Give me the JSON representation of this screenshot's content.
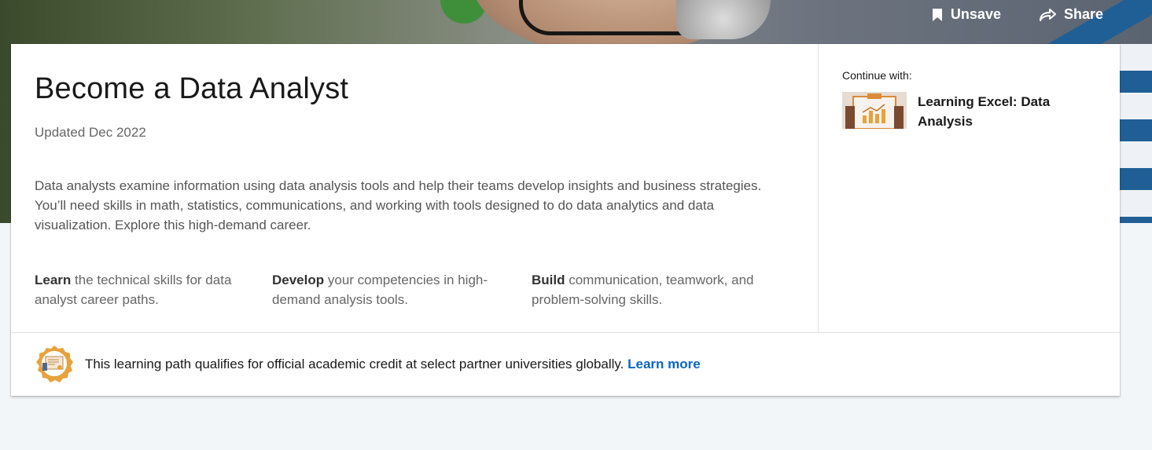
{
  "header": {
    "unsave_label": "Unsave",
    "share_label": "Share"
  },
  "path": {
    "title": "Become a Data Analyst",
    "updated": "Updated Dec 2022",
    "description": "Data analysts examine information using data analysis tools and help their teams develop insights and business strategies. You’ll need skills in math, statistics, communications, and working with tools designed to do data analytics and data visualization. Explore this high-demand career.",
    "highlights": [
      {
        "bold": "Learn",
        "text": " the technical skills for data analyst career paths."
      },
      {
        "bold": "Develop",
        "text": " your competencies in high-demand analysis tools."
      },
      {
        "bold": "Build",
        "text": " communication, teamwork, and problem-solving skills."
      }
    ]
  },
  "continue": {
    "label": "Continue with:",
    "course_title": "Learning Excel: Data Analysis"
  },
  "footer": {
    "text": "This learning path qualifies for official academic credit at select partner universities globally.",
    "link": "Learn more"
  },
  "icons": {
    "unsave": "bookmark-icon",
    "share": "share-arrow-icon",
    "badge": "academic-credit-badge-icon"
  },
  "colors": {
    "accent_link": "#0a66c2",
    "badge": "#e8a23c"
  }
}
